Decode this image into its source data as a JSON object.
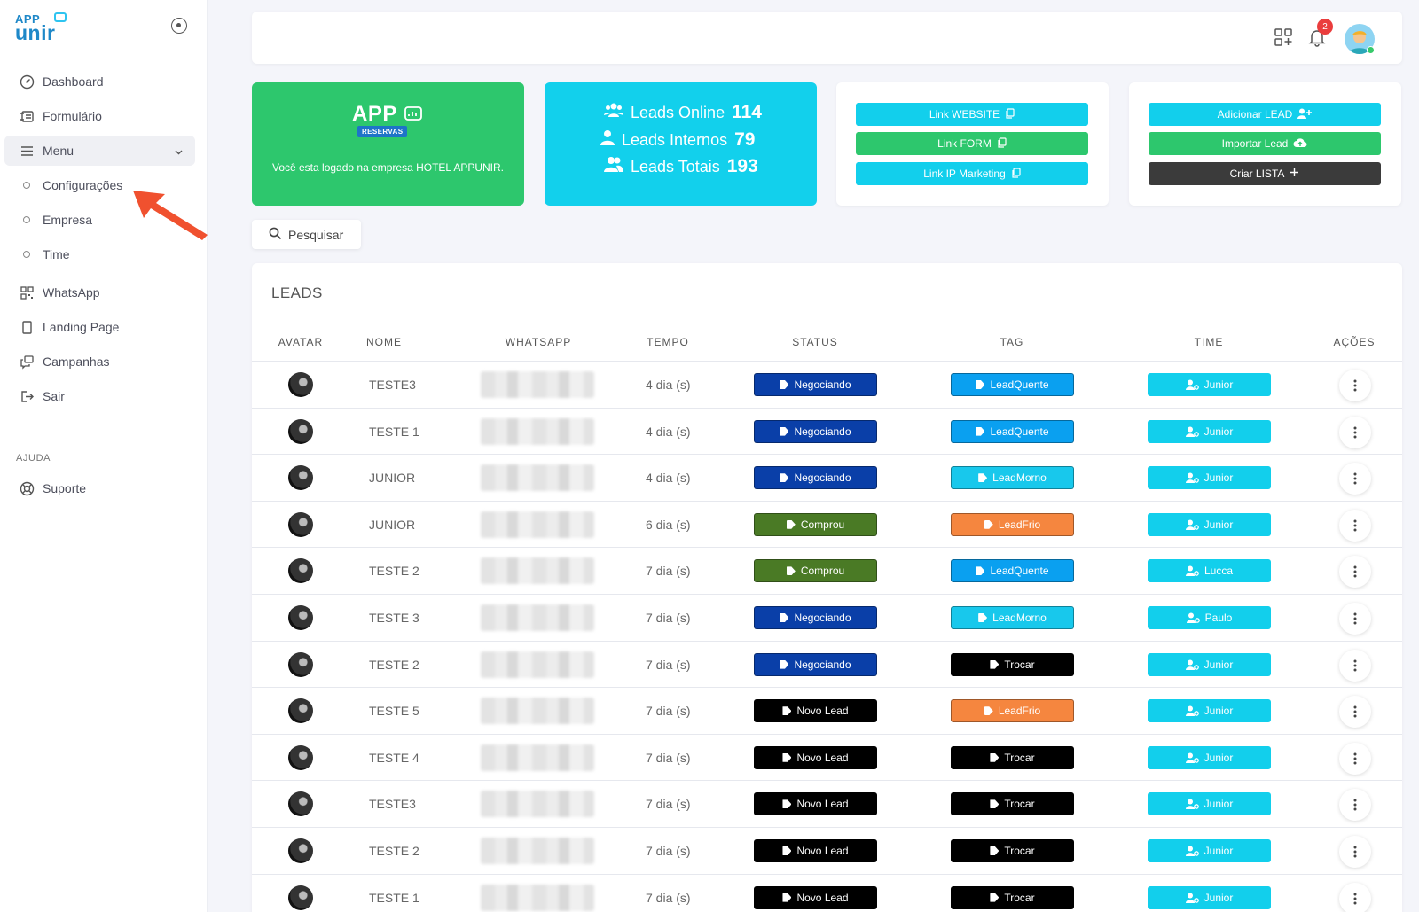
{
  "brand": {
    "logo_top": "APP",
    "logo_bottom": "unir"
  },
  "sidebar": {
    "items": [
      {
        "label": "Dashboard",
        "icon": "dashboard-icon"
      },
      {
        "label": "Formulário",
        "icon": "form-icon"
      },
      {
        "label": "Menu",
        "icon": "menu-icon"
      },
      {
        "label": "Configurações",
        "icon": "circle-icon"
      },
      {
        "label": "Empresa",
        "icon": "circle-icon"
      },
      {
        "label": "Time",
        "icon": "circle-icon"
      },
      {
        "label": "WhatsApp",
        "icon": "qr-icon"
      },
      {
        "label": "Landing Page",
        "icon": "page-icon"
      },
      {
        "label": "Campanhas",
        "icon": "chat-icon"
      },
      {
        "label": "Sair",
        "icon": "logout-icon"
      }
    ],
    "section_help": "AJUDA",
    "support": "Suporte"
  },
  "topbar": {
    "notification_count": "2"
  },
  "cards": {
    "company": {
      "logo": "APP",
      "logo_badge": "RESERVAS",
      "message": "Você esta logado na empresa HOTEL APPUNIR."
    },
    "stats": [
      {
        "label": "Leads Online",
        "value": "114"
      },
      {
        "label": "Leads Internos",
        "value": "79"
      },
      {
        "label": "Leads Totais",
        "value": "193"
      }
    ],
    "links": [
      "Link WEBSITE",
      "Link FORM",
      "Link IP Marketing"
    ],
    "actions": [
      "Adicionar LEAD",
      "Importar Lead",
      "Criar LISTA"
    ]
  },
  "search": {
    "label": "Pesquisar"
  },
  "table": {
    "title": "LEADS",
    "headers": [
      "AVATAR",
      "NOME",
      "WHATSAPP",
      "TEMPO",
      "STATUS",
      "TAG",
      "TIME",
      "AÇÕES"
    ],
    "rows": [
      {
        "name": "TESTE3",
        "tempo": "4 dia (s)",
        "status": "Negociando",
        "tag": "LeadQuente",
        "team": "Junior"
      },
      {
        "name": "TESTE 1",
        "tempo": "4 dia (s)",
        "status": "Negociando",
        "tag": "LeadQuente",
        "team": "Junior"
      },
      {
        "name": "JUNIOR",
        "tempo": "4 dia (s)",
        "status": "Negociando",
        "tag": "LeadMorno",
        "team": "Junior"
      },
      {
        "name": "JUNIOR",
        "tempo": "6 dia (s)",
        "status": "Comprou",
        "tag": "LeadFrio",
        "team": "Junior"
      },
      {
        "name": "TESTE 2",
        "tempo": "7 dia (s)",
        "status": "Comprou",
        "tag": "LeadQuente",
        "team": "Lucca"
      },
      {
        "name": "TESTE 3",
        "tempo": "7 dia (s)",
        "status": "Negociando",
        "tag": "LeadMorno",
        "team": "Paulo"
      },
      {
        "name": "TESTE 2",
        "tempo": "7 dia (s)",
        "status": "Negociando",
        "tag": "Trocar",
        "team": "Junior"
      },
      {
        "name": "TESTE 5",
        "tempo": "7 dia (s)",
        "status": "Novo Lead",
        "tag": "LeadFrio",
        "team": "Junior"
      },
      {
        "name": "TESTE 4",
        "tempo": "7 dia (s)",
        "status": "Novo Lead",
        "tag": "Trocar",
        "team": "Junior"
      },
      {
        "name": "TESTE3",
        "tempo": "7 dia (s)",
        "status": "Novo Lead",
        "tag": "Trocar",
        "team": "Junior"
      },
      {
        "name": "TESTE 2",
        "tempo": "7 dia (s)",
        "status": "Novo Lead",
        "tag": "Trocar",
        "team": "Junior"
      },
      {
        "name": "TESTE 1",
        "tempo": "7 dia (s)",
        "status": "Novo Lead",
        "tag": "Trocar",
        "team": "Junior"
      }
    ]
  },
  "colors": {
    "Negociando": "#0a3fa8",
    "Comprou": "#4a7a25",
    "Novo Lead": "#000000",
    "LeadQuente": "#0aa0f0",
    "LeadMorno": "#18c8ec",
    "LeadFrio": "#f5863f",
    "Trocar": "#000000",
    "accent": "#12cfec",
    "success": "#2dc76d"
  }
}
